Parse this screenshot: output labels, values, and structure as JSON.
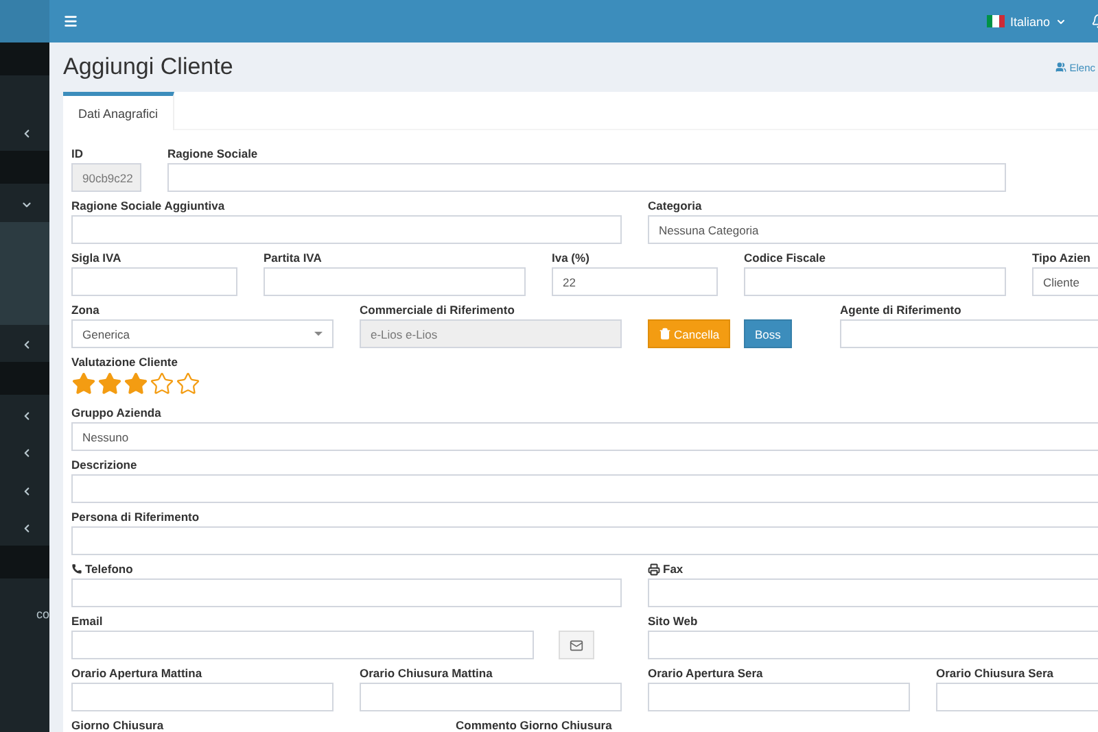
{
  "sidebar": {
    "items": [
      {
        "kind": "header"
      },
      {
        "kind": "panel",
        "expanded": false
      },
      {
        "kind": "header"
      },
      {
        "kind": "item",
        "expanded": true
      },
      {
        "kind": "submenu"
      },
      {
        "kind": "item",
        "expanded": false
      },
      {
        "kind": "header"
      },
      {
        "kind": "item",
        "expanded": false
      },
      {
        "kind": "item",
        "expanded": false
      },
      {
        "kind": "item",
        "expanded": false
      },
      {
        "kind": "item",
        "expanded": false
      },
      {
        "kind": "header"
      },
      {
        "kind": "link",
        "label": "co"
      }
    ]
  },
  "navbar": {
    "language": "Italiano"
  },
  "page": {
    "title": "Aggiungi Cliente",
    "link": "Elenc"
  },
  "tabs": [
    {
      "label": "Dati Anagrafici",
      "selected": true
    }
  ],
  "form": {
    "rows": [
      [
        {
          "kind": "input",
          "label": "ID",
          "value": "90cb9c22",
          "disabled": true
        },
        {
          "kind": "input",
          "label": "Ragione Sociale"
        }
      ],
      [
        {
          "kind": "input",
          "label": "Ragione Sociale Aggiuntiva"
        },
        {
          "kind": "select",
          "label": "Categoria",
          "value": "Nessuna Categoria"
        }
      ],
      [
        {
          "kind": "input",
          "label": "Sigla IVA"
        },
        {
          "kind": "input",
          "label": "Partita IVA"
        },
        {
          "kind": "input",
          "label": "Iva (%)",
          "value": "22"
        },
        {
          "kind": "input",
          "label": "Codice Fiscale"
        },
        {
          "kind": "select",
          "label": "Tipo Azien",
          "value": "Cliente"
        }
      ],
      [
        {
          "kind": "select",
          "label": "Zona",
          "value": "Generica"
        },
        {
          "kind": "input",
          "label": "Commerciale di Riferimento",
          "value": "e-Lios e-Lios",
          "disabled": true
        },
        {
          "kind": "button",
          "label": "Cancella"
        },
        {
          "kind": "button",
          "label": "Boss"
        },
        {
          "kind": "input",
          "label": "Agente di Riferimento"
        }
      ],
      [
        {
          "kind": "stars",
          "label": "Valutazione Cliente",
          "stars": 3
        }
      ],
      [
        {
          "kind": "select",
          "label": "Gruppo Azienda",
          "value": "Nessuno"
        }
      ],
      [
        {
          "kind": "input",
          "label": "Descrizione"
        }
      ],
      [
        {
          "kind": "input",
          "label": "Persona di Riferimento"
        }
      ],
      [
        {
          "kind": "input",
          "label": "Telefono"
        },
        {
          "kind": "input",
          "label": "Fax"
        }
      ],
      [
        {
          "kind": "email",
          "label": "Email"
        },
        {
          "kind": "input",
          "label": "Sito Web"
        }
      ],
      [
        {
          "kind": "input",
          "label": "Orario Apertura Mattina"
        },
        {
          "kind": "input",
          "label": "Orario Chiusura Mattina"
        },
        {
          "kind": "input",
          "label": "Orario Apertura Sera"
        },
        {
          "kind": "input",
          "label": "Orario Chiusura Sera"
        }
      ],
      [
        {
          "kind": "label",
          "label": "Giorno Chiusura"
        },
        {
          "kind": "label",
          "label": "Commento Giorno Chiusura"
        }
      ]
    ]
  }
}
